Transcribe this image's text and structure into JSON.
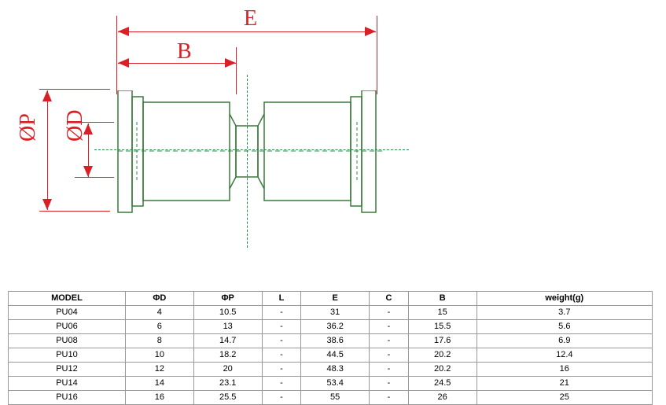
{
  "diagram": {
    "labels": {
      "E": "E",
      "B": "B",
      "phiP": "ØP",
      "phiD": "ØD"
    }
  },
  "chart_data": {
    "type": "table",
    "columns": [
      "MODEL",
      "ΦD",
      "ΦP",
      "L",
      "E",
      "C",
      "B",
      "weight(g)"
    ],
    "rows": [
      {
        "model": "PU04",
        "phiD": "4",
        "phiP": "10.5",
        "L": "-",
        "E": "31",
        "C": "-",
        "B": "15",
        "weight": "3.7"
      },
      {
        "model": "PU06",
        "phiD": "6",
        "phiP": "13",
        "L": "-",
        "E": "36.2",
        "C": "-",
        "B": "15.5",
        "weight": "5.6"
      },
      {
        "model": "PU08",
        "phiD": "8",
        "phiP": "14.7",
        "L": "-",
        "E": "38.6",
        "C": "-",
        "B": "17.6",
        "weight": "6.9"
      },
      {
        "model": "PU10",
        "phiD": "10",
        "phiP": "18.2",
        "L": "-",
        "E": "44.5",
        "C": "-",
        "B": "20.2",
        "weight": "12.4"
      },
      {
        "model": "PU12",
        "phiD": "12",
        "phiP": "20",
        "L": "-",
        "E": "48.3",
        "C": "-",
        "B": "20.2",
        "weight": "16"
      },
      {
        "model": "PU14",
        "phiD": "14",
        "phiP": "23.1",
        "L": "-",
        "E": "53.4",
        "C": "-",
        "B": "24.5",
        "weight": "21"
      },
      {
        "model": "PU16",
        "phiD": "16",
        "phiP": "25.5",
        "L": "-",
        "E": "55",
        "C": "-",
        "B": "26",
        "weight": "25"
      }
    ]
  }
}
